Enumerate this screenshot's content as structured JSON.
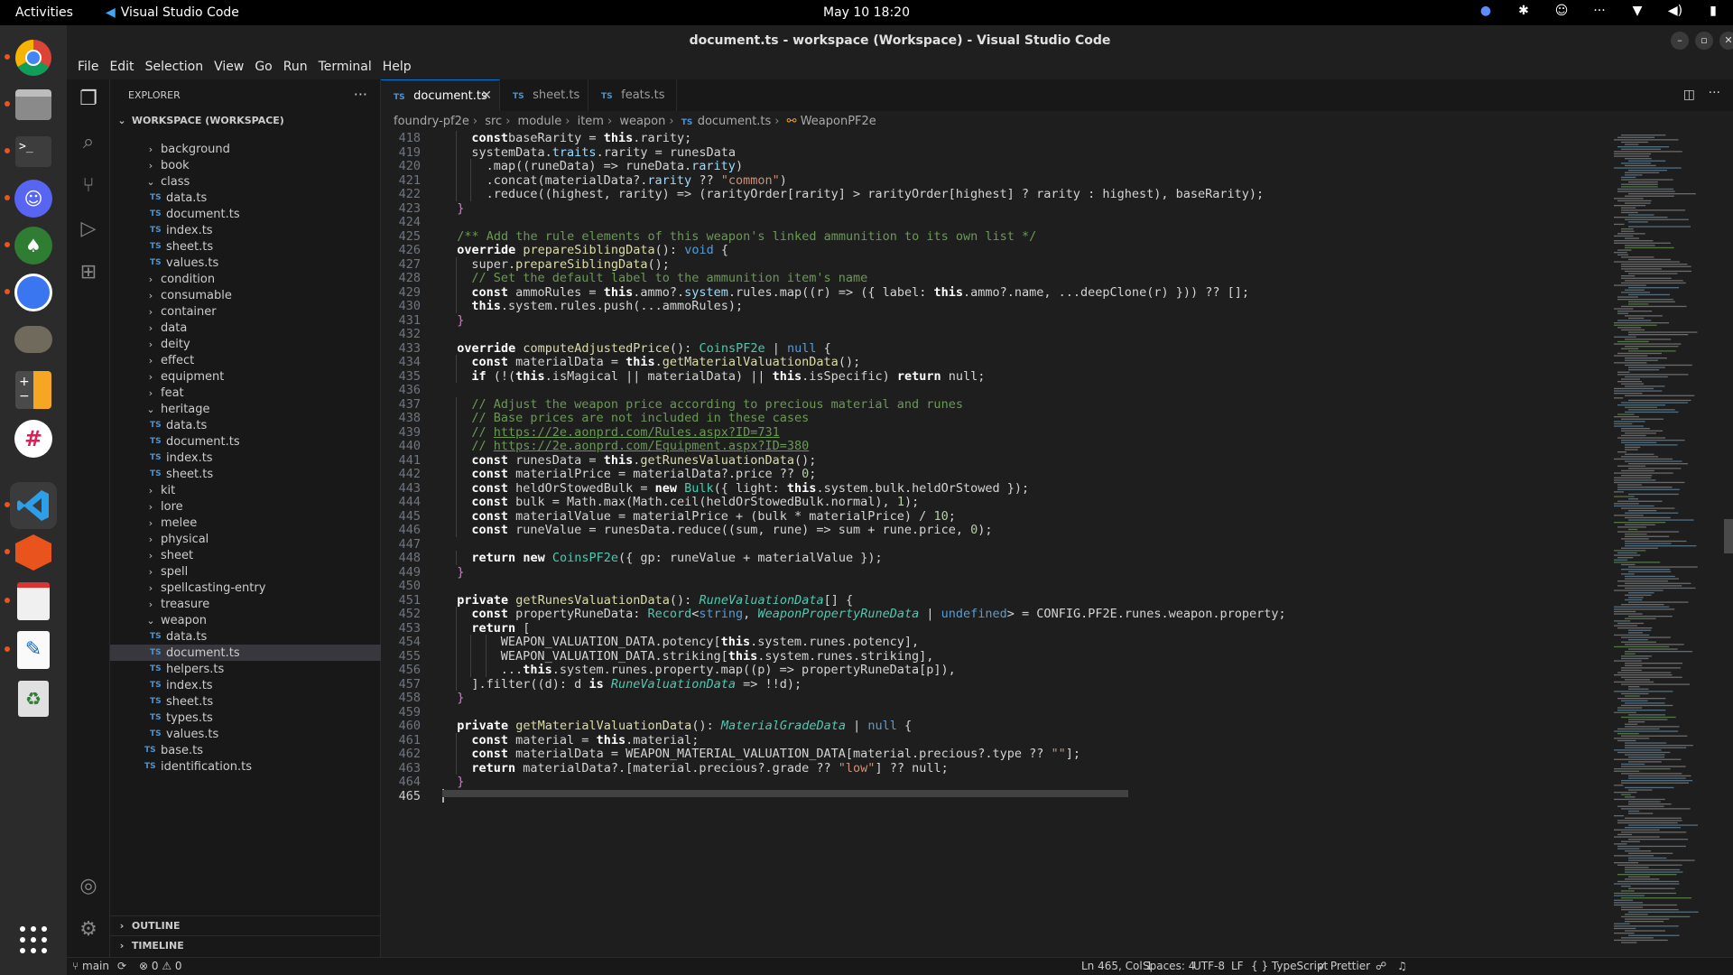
{
  "topbar": {
    "activities": "Activities",
    "app_name": "Visual Studio Code",
    "clock": "May 10  18:20",
    "tray_icons": [
      "chrome-indicator-icon",
      "slack-indicator-icon",
      "discord-indicator-icon",
      "more-icon",
      "wifi-icon",
      "volume-icon",
      "battery-icon"
    ]
  },
  "dock": {
    "items": [
      "Google Chrome",
      "Files",
      "Terminal",
      "Discord",
      "Inkscape",
      "Signal",
      "GIMP",
      "Calculator",
      "Slack",
      "Visual Studio Code",
      "Foundry VTT",
      "Document Viewer",
      "Text Editor",
      "Trash"
    ]
  },
  "window": {
    "title": "document.ts - workspace (Workspace) - Visual Studio Code",
    "controls": {
      "minimize": "–",
      "maximize": "▫",
      "close": "✕"
    }
  },
  "menu": [
    "File",
    "Edit",
    "Selection",
    "View",
    "Go",
    "Run",
    "Terminal",
    "Help"
  ],
  "sidebar": {
    "title": "EXPLORER",
    "more": "···",
    "workspace": "WORKSPACE (WORKSPACE)",
    "outline": "OUTLINE",
    "timeline": "TIMELINE",
    "tree": [
      {
        "label": "background",
        "type": "folder",
        "open": false,
        "level": 1
      },
      {
        "label": "book",
        "type": "folder",
        "open": false,
        "level": 1
      },
      {
        "label": "class",
        "type": "folder",
        "open": true,
        "level": 1
      },
      {
        "label": "data.ts",
        "type": "file",
        "level": 2
      },
      {
        "label": "document.ts",
        "type": "file",
        "level": 2
      },
      {
        "label": "index.ts",
        "type": "file",
        "level": 2
      },
      {
        "label": "sheet.ts",
        "type": "file",
        "level": 2
      },
      {
        "label": "values.ts",
        "type": "file",
        "level": 2
      },
      {
        "label": "condition",
        "type": "folder",
        "open": false,
        "level": 1
      },
      {
        "label": "consumable",
        "type": "folder",
        "open": false,
        "level": 1
      },
      {
        "label": "container",
        "type": "folder",
        "open": false,
        "level": 1
      },
      {
        "label": "data",
        "type": "folder",
        "open": false,
        "level": 1
      },
      {
        "label": "deity",
        "type": "folder",
        "open": false,
        "level": 1
      },
      {
        "label": "effect",
        "type": "folder",
        "open": false,
        "level": 1
      },
      {
        "label": "equipment",
        "type": "folder",
        "open": false,
        "level": 1
      },
      {
        "label": "feat",
        "type": "folder",
        "open": false,
        "level": 1
      },
      {
        "label": "heritage",
        "type": "folder",
        "open": true,
        "level": 1
      },
      {
        "label": "data.ts",
        "type": "file",
        "level": 2
      },
      {
        "label": "document.ts",
        "type": "file",
        "level": 2
      },
      {
        "label": "index.ts",
        "type": "file",
        "level": 2
      },
      {
        "label": "sheet.ts",
        "type": "file",
        "level": 2
      },
      {
        "label": "kit",
        "type": "folder",
        "open": false,
        "level": 1
      },
      {
        "label": "lore",
        "type": "folder",
        "open": false,
        "level": 1
      },
      {
        "label": "melee",
        "type": "folder",
        "open": false,
        "level": 1
      },
      {
        "label": "physical",
        "type": "folder",
        "open": false,
        "level": 1
      },
      {
        "label": "sheet",
        "type": "folder",
        "open": false,
        "level": 1
      },
      {
        "label": "spell",
        "type": "folder",
        "open": false,
        "level": 1
      },
      {
        "label": "spellcasting-entry",
        "type": "folder",
        "open": false,
        "level": 1
      },
      {
        "label": "treasure",
        "type": "folder",
        "open": false,
        "level": 1
      },
      {
        "label": "weapon",
        "type": "folder",
        "open": true,
        "level": 1
      },
      {
        "label": "data.ts",
        "type": "file",
        "level": 2
      },
      {
        "label": "document.ts",
        "type": "file",
        "level": 2,
        "selected": true
      },
      {
        "label": "helpers.ts",
        "type": "file",
        "level": 2
      },
      {
        "label": "index.ts",
        "type": "file",
        "level": 2
      },
      {
        "label": "sheet.ts",
        "type": "file",
        "level": 2
      },
      {
        "label": "types.ts",
        "type": "file",
        "level": 2
      },
      {
        "label": "values.ts",
        "type": "file",
        "level": 2
      },
      {
        "label": "base.ts",
        "type": "file",
        "level": 1
      },
      {
        "label": "identification.ts",
        "type": "file",
        "level": 1
      }
    ]
  },
  "tabs": [
    {
      "label": "document.ts",
      "active": true
    },
    {
      "label": "sheet.ts",
      "active": false
    },
    {
      "label": "feats.ts",
      "active": false
    }
  ],
  "ts_badge": "TS",
  "breadcrumbs": [
    "foundry-pf2e",
    "src",
    "module",
    "item",
    "weapon",
    "document.ts",
    "WeaponPF2e"
  ],
  "code": {
    "first_line": 418,
    "current_line": 465,
    "lines": [
      [
        [
          4,
          ""
        ],
        [
          "kw",
          "const"
        ],
        [
          "",
          "baseRarity = "
        ],
        [
          "kw",
          "this"
        ],
        [
          "",
          ".rarity;"
        ]
      ],
      [
        [
          4,
          ""
        ],
        [
          "",
          "systemData."
        ],
        [
          "pr",
          "traits"
        ],
        [
          "",
          ".rarity = runesData"
        ]
      ],
      [
        [
          6,
          ""
        ],
        [
          "",
          ".map((runeData) => runeData."
        ],
        [
          "pr",
          "rarity"
        ],
        [
          "",
          ")"
        ]
      ],
      [
        [
          6,
          ""
        ],
        [
          "",
          ".concat(materialData?."
        ],
        [
          "pr",
          "rarity"
        ],
        [
          "",
          " ?? "
        ],
        [
          "st",
          "\"common\""
        ],
        [
          "",
          ")"
        ]
      ],
      [
        [
          6,
          ""
        ],
        [
          "",
          ".reduce((highest, rarity) => (rarityOrder[rarity] > rarityOrder[highest] ? rarity : highest), baseRarity);"
        ]
      ],
      [
        [
          2,
          ""
        ],
        [
          "pu",
          "}"
        ]
      ],
      [
        [
          0,
          ""
        ]
      ],
      [
        [
          2,
          ""
        ],
        [
          "cm",
          "/** Add the rule elements of this weapon's linked ammunition to its own list */"
        ]
      ],
      [
        [
          2,
          ""
        ],
        [
          "kw",
          "override"
        ],
        [
          "",
          " "
        ],
        [
          "fn",
          "prepareSiblingData"
        ],
        [
          "",
          "(): "
        ],
        [
          "kw2",
          "void"
        ],
        [
          "",
          " {"
        ]
      ],
      [
        [
          4,
          ""
        ],
        [
          "",
          "super."
        ],
        [
          "fn",
          "prepareSiblingData"
        ],
        [
          "",
          "();"
        ]
      ],
      [
        [
          4,
          ""
        ],
        [
          "cm",
          "// Set the default label to the ammunition item's name"
        ]
      ],
      [
        [
          4,
          ""
        ],
        [
          "kw",
          "const"
        ],
        [
          "",
          " ammoRules = "
        ],
        [
          "kw",
          "this"
        ],
        [
          "",
          ".ammo?."
        ],
        [
          "pr",
          "system"
        ],
        [
          "",
          ".rules.map((r) => ({ label: "
        ],
        [
          "kw",
          "this"
        ],
        [
          "",
          ".ammo?.name, ...deepClone(r) })) ?? [];"
        ]
      ],
      [
        [
          4,
          ""
        ],
        [
          "kw",
          "this"
        ],
        [
          "",
          ".system.rules.push(...ammoRules);"
        ]
      ],
      [
        [
          2,
          ""
        ],
        [
          "pu",
          "}"
        ]
      ],
      [
        [
          0,
          ""
        ]
      ],
      [
        [
          2,
          ""
        ],
        [
          "kw",
          "override"
        ],
        [
          "",
          " "
        ],
        [
          "fn",
          "computeAdjustedPrice"
        ],
        [
          "",
          "(): "
        ],
        [
          "ty",
          "CoinsPF2e"
        ],
        [
          "",
          " | "
        ],
        [
          "kw2",
          "null"
        ],
        [
          "",
          " {"
        ]
      ],
      [
        [
          4,
          ""
        ],
        [
          "kw",
          "const"
        ],
        [
          "",
          " materialData = "
        ],
        [
          "kw",
          "this"
        ],
        [
          "",
          "."
        ],
        [
          "fn",
          "getMaterialValuationData"
        ],
        [
          "",
          "();"
        ]
      ],
      [
        [
          4,
          ""
        ],
        [
          "kw",
          "if"
        ],
        [
          "",
          " (!("
        ],
        [
          "kw",
          "this"
        ],
        [
          "",
          ".isMagical || materialData) || "
        ],
        [
          "kw",
          "this"
        ],
        [
          "",
          ".isSpecific) "
        ],
        [
          "kw",
          "return"
        ],
        [
          "",
          " null;"
        ]
      ],
      [
        [
          0,
          ""
        ]
      ],
      [
        [
          4,
          ""
        ],
        [
          "cm",
          "// Adjust the weapon price according to precious material and runes"
        ]
      ],
      [
        [
          4,
          ""
        ],
        [
          "cm",
          "// Base prices are not included in these cases"
        ]
      ],
      [
        [
          4,
          ""
        ],
        [
          "cm",
          "// "
        ],
        [
          "cmu",
          "https://2e.aonprd.com/Rules.aspx?ID=731"
        ]
      ],
      [
        [
          4,
          ""
        ],
        [
          "cm",
          "// "
        ],
        [
          "cmu",
          "https://2e.aonprd.com/Equipment.aspx?ID=380"
        ]
      ],
      [
        [
          4,
          ""
        ],
        [
          "kw",
          "const"
        ],
        [
          "",
          " runesData = "
        ],
        [
          "kw",
          "this"
        ],
        [
          "",
          "."
        ],
        [
          "fn",
          "getRunesValuationData"
        ],
        [
          "",
          "();"
        ]
      ],
      [
        [
          4,
          ""
        ],
        [
          "kw",
          "const"
        ],
        [
          "",
          " materialPrice = materialData?.price ?? "
        ],
        [
          "nu",
          "0"
        ],
        [
          "",
          ";"
        ]
      ],
      [
        [
          4,
          ""
        ],
        [
          "kw",
          "const"
        ],
        [
          "",
          " heldOrStowedBulk = "
        ],
        [
          "kw",
          "new"
        ],
        [
          "",
          " "
        ],
        [
          "ty",
          "Bulk"
        ],
        [
          "",
          "({ light: "
        ],
        [
          "kw",
          "this"
        ],
        [
          "",
          ".system.bulk.heldOrStowed });"
        ]
      ],
      [
        [
          4,
          ""
        ],
        [
          "kw",
          "const"
        ],
        [
          "",
          " bulk = Math.max(Math.ceil(heldOrStowedBulk.normal), "
        ],
        [
          "nu",
          "1"
        ],
        [
          "",
          ");"
        ]
      ],
      [
        [
          4,
          ""
        ],
        [
          "kw",
          "const"
        ],
        [
          "",
          " materialValue = materialPrice + (bulk * materialPrice) / "
        ],
        [
          "nu",
          "10"
        ],
        [
          "",
          ";"
        ]
      ],
      [
        [
          4,
          ""
        ],
        [
          "kw",
          "const"
        ],
        [
          "",
          " runeValue = runesData.reduce((sum, rune) => sum + rune.price, "
        ],
        [
          "nu",
          "0"
        ],
        [
          "",
          ");"
        ]
      ],
      [
        [
          0,
          ""
        ]
      ],
      [
        [
          4,
          ""
        ],
        [
          "kw",
          "return"
        ],
        [
          "",
          " "
        ],
        [
          "kw",
          "new"
        ],
        [
          "",
          " "
        ],
        [
          "ty",
          "CoinsPF2e"
        ],
        [
          "",
          "({ gp: runeValue + materialValue });"
        ]
      ],
      [
        [
          2,
          ""
        ],
        [
          "pu",
          "}"
        ]
      ],
      [
        [
          0,
          ""
        ]
      ],
      [
        [
          2,
          ""
        ],
        [
          "kw",
          "private"
        ],
        [
          "",
          " "
        ],
        [
          "fn",
          "getRunesValuationData"
        ],
        [
          "",
          "(): "
        ],
        [
          "tyi",
          "RuneValuationData"
        ],
        [
          "",
          "[] {"
        ]
      ],
      [
        [
          4,
          ""
        ],
        [
          "kw",
          "const"
        ],
        [
          "",
          " propertyRuneData: "
        ],
        [
          "ty",
          "Record"
        ],
        [
          "",
          "<"
        ],
        [
          "kw2",
          "string"
        ],
        [
          "",
          ", "
        ],
        [
          "tyi",
          "WeaponPropertyRuneData"
        ],
        [
          "",
          " | "
        ],
        [
          "kw2",
          "undefined"
        ],
        [
          "",
          "> = CONFIG.PF2E.runes.weapon.property;"
        ]
      ],
      [
        [
          4,
          ""
        ],
        [
          "kw",
          "return"
        ],
        [
          "",
          " ["
        ]
      ],
      [
        [
          8,
          ""
        ],
        [
          "",
          "WEAPON_VALUATION_DATA.potency["
        ],
        [
          "kw",
          "this"
        ],
        [
          "",
          ".system.runes.potency],"
        ]
      ],
      [
        [
          8,
          ""
        ],
        [
          "",
          "WEAPON_VALUATION_DATA.striking["
        ],
        [
          "kw",
          "this"
        ],
        [
          "",
          ".system.runes.striking],"
        ]
      ],
      [
        [
          8,
          ""
        ],
        [
          "",
          "..."
        ],
        [
          "kw",
          "this"
        ],
        [
          "",
          ".system.runes.property.map((p) => propertyRuneData[p]),"
        ]
      ],
      [
        [
          4,
          ""
        ],
        [
          "",
          "].filter((d): d "
        ],
        [
          "kw",
          "is"
        ],
        [
          "",
          " "
        ],
        [
          "tyi",
          "RuneValuationData"
        ],
        [
          "",
          " => !!d);"
        ]
      ],
      [
        [
          2,
          ""
        ],
        [
          "pu",
          "}"
        ]
      ],
      [
        [
          0,
          ""
        ]
      ],
      [
        [
          2,
          ""
        ],
        [
          "kw",
          "private"
        ],
        [
          "",
          " "
        ],
        [
          "fn",
          "getMaterialValuationData"
        ],
        [
          "",
          "(): "
        ],
        [
          "tyi",
          "MaterialGradeData"
        ],
        [
          "",
          " | "
        ],
        [
          "kw2",
          "null"
        ],
        [
          "",
          " {"
        ]
      ],
      [
        [
          4,
          ""
        ],
        [
          "kw",
          "const"
        ],
        [
          "",
          " material = "
        ],
        [
          "kw",
          "this"
        ],
        [
          "",
          ".material;"
        ]
      ],
      [
        [
          4,
          ""
        ],
        [
          "kw",
          "const"
        ],
        [
          "",
          " materialData = WEAPON_MATERIAL_VALUATION_DATA[material.precious?.type ?? "
        ],
        [
          "st",
          "\"\""
        ],
        [
          "",
          "];"
        ]
      ],
      [
        [
          4,
          ""
        ],
        [
          "kw",
          "return"
        ],
        [
          "",
          " materialData?.[material.precious?.grade ?? "
        ],
        [
          "st",
          "\"low\""
        ],
        [
          "",
          "] ?? null;"
        ]
      ],
      [
        [
          2,
          ""
        ],
        [
          "pu",
          "}"
        ]
      ],
      [
        [
          0,
          ""
        ]
      ]
    ]
  },
  "statusbar": {
    "branch": "main",
    "sync": "⟳",
    "errors": "⊗ 0",
    "warnings": "⚠ 0",
    "position": "Ln 465, Col 1",
    "spaces": "Spaces: 4",
    "encoding": "UTF-8",
    "eol": "LF",
    "language": "{ } TypeScript",
    "prettier": "✓ Prettier"
  }
}
